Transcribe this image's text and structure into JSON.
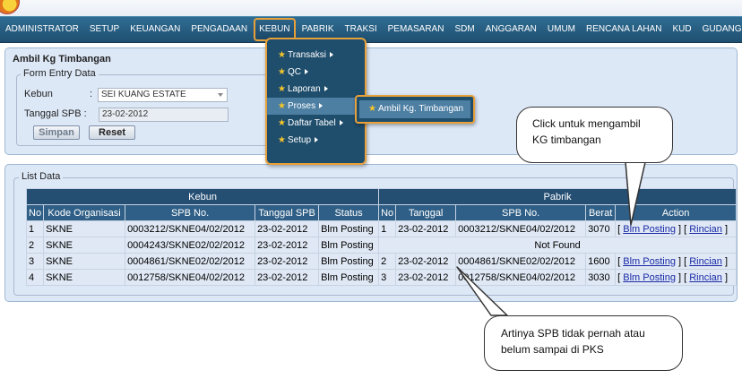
{
  "nav": {
    "items": [
      "ADMINISTRATOR",
      "SETUP",
      "KEUANGAN",
      "PENGADAAN",
      "KEBUN",
      "PABRIK",
      "TRAKSI",
      "PEMASARAN",
      "SDM",
      "ANGGARAN",
      "UMUM",
      "RENCANA LAHAN",
      "KUD",
      "GUDANG"
    ],
    "active": "KEBUN"
  },
  "kebun_menu": {
    "items": [
      "Transaksi",
      "QC",
      "Laporan",
      "Proses",
      "Daftar Tabel",
      "Setup"
    ],
    "selected": "Proses",
    "submenu_item": "Ambil Kg. Timbangan"
  },
  "form": {
    "title": "Ambil Kg Timbangan",
    "legend": "Form Entry Data",
    "kebun_label": "Kebun",
    "kebun_colon": ":",
    "kebun_value": "SEI KUANG ESTATE",
    "tanggal_label": "Tanggal SPB :",
    "tanggal_value": "23-02-2012",
    "save_label": "Simpan",
    "reset_label": "Reset"
  },
  "list": {
    "legend": "List Data",
    "group_kebun": "Kebun",
    "group_pabrik": "Pabrik",
    "columns": [
      "No",
      "Kode Organisasi",
      "SPB No.",
      "Tanggal SPB",
      "Status",
      "No",
      "Tanggal",
      "SPB No.",
      "Berat",
      "Action"
    ],
    "rows": [
      {
        "no": "1",
        "kode": "SKNE",
        "spb": "0003212/SKNE04/02/2012",
        "tgl": "23-02-2012",
        "status": "Blm Posting",
        "p_no": "1",
        "p_tgl": "23-02-2012",
        "p_spb": "0003212/SKNE04/02/2012",
        "berat": "3070",
        "posting": "Blm Posting",
        "rincian": "Rincian",
        "not_found": ""
      },
      {
        "no": "2",
        "kode": "SKNE",
        "spb": "0004243/SKNE02/02/2012",
        "tgl": "23-02-2012",
        "status": "Blm Posting",
        "p_no": "",
        "p_tgl": "",
        "p_spb": "",
        "berat": "",
        "posting": "",
        "rincian": "",
        "not_found": "Not Found"
      },
      {
        "no": "3",
        "kode": "SKNE",
        "spb": "0004861/SKNE02/02/2012",
        "tgl": "23-02-2012",
        "status": "Blm Posting",
        "p_no": "2",
        "p_tgl": "23-02-2012",
        "p_spb": "0004861/SKNE02/02/2012",
        "berat": "1600",
        "posting": "Blm Posting",
        "rincian": "Rincian",
        "not_found": ""
      },
      {
        "no": "4",
        "kode": "SKNE",
        "spb": "0012758/SKNE04/02/2012",
        "tgl": "23-02-2012",
        "status": "Blm Posting",
        "p_no": "3",
        "p_tgl": "23-02-2012",
        "p_spb": "0012758/SKNE04/02/2012",
        "berat": "3030",
        "posting": "Blm Posting",
        "rincian": "Rincian",
        "not_found": ""
      }
    ]
  },
  "callouts": {
    "first": [
      "Click untuk mengambil",
      "KG timbangan"
    ],
    "second": [
      "Artinya SPB tidak pernah atau",
      "belum sampai di PKS"
    ]
  },
  "icons": {
    "star": "star-icon",
    "arrow": "arrow-right-icon",
    "logo": "app-logo"
  },
  "colors": {
    "nav": "#1f4f70",
    "accent": "#e8a13a",
    "panel": "#dde8f7",
    "header": "#2f5f86"
  }
}
